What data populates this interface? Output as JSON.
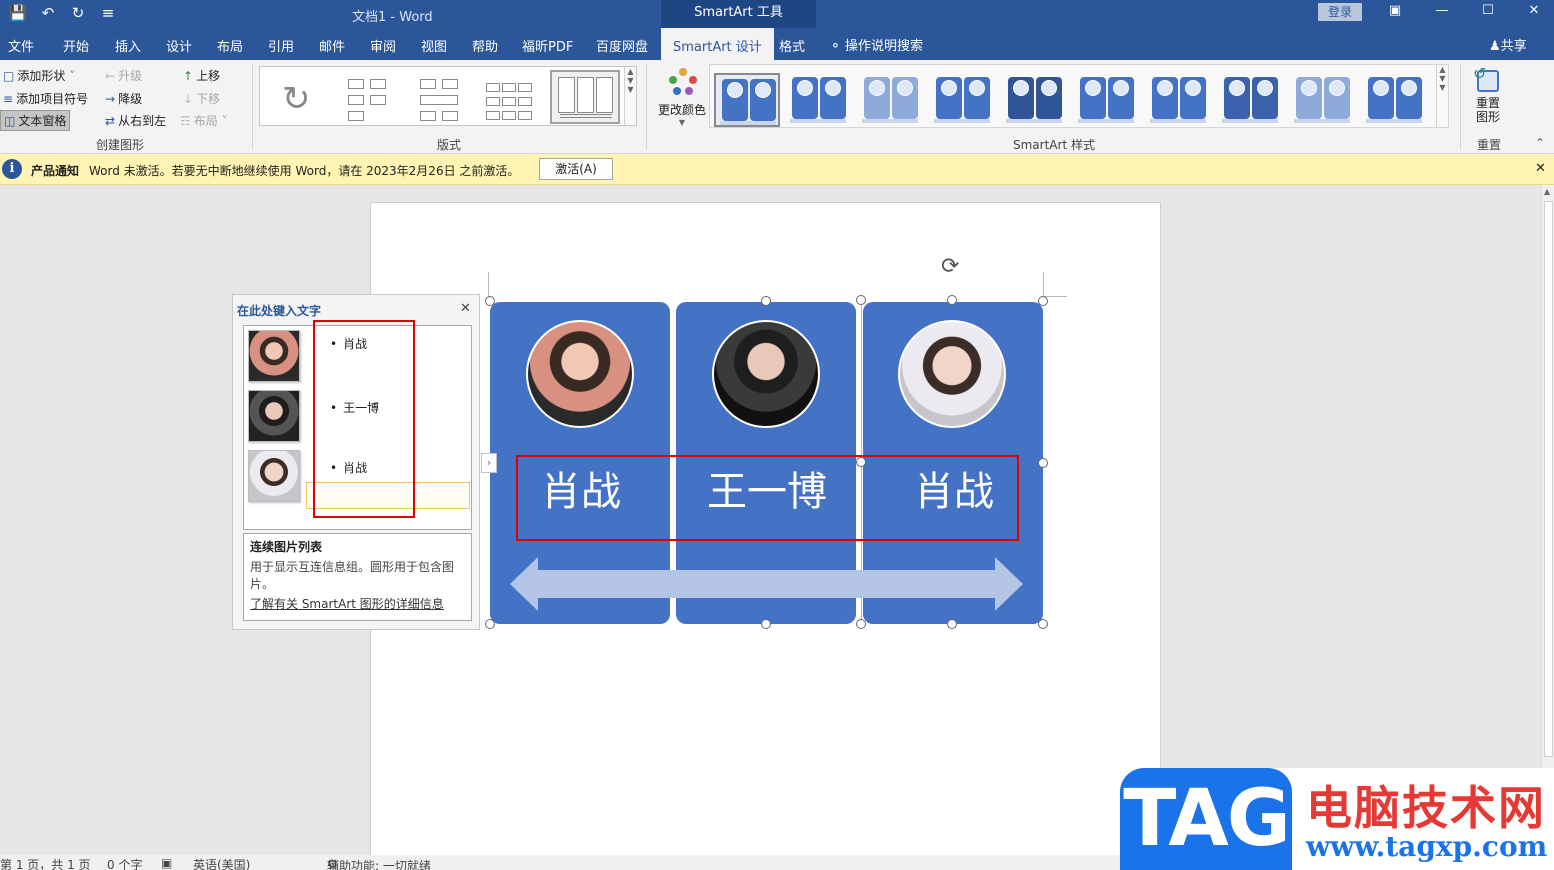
{
  "titlebar": {
    "doc_title": "文档1  -  Word",
    "tools_title": "SmartArt 工具",
    "login": "登录"
  },
  "tabs": [
    {
      "label": "文件"
    },
    {
      "label": "开始"
    },
    {
      "label": "插入"
    },
    {
      "label": "设计"
    },
    {
      "label": "布局"
    },
    {
      "label": "引用"
    },
    {
      "label": "邮件"
    },
    {
      "label": "审阅"
    },
    {
      "label": "视图"
    },
    {
      "label": "帮助"
    },
    {
      "label": "福昕PDF"
    },
    {
      "label": "百度网盘"
    },
    {
      "label": "SmartArt 设计"
    },
    {
      "label": "格式"
    }
  ],
  "tell_me": "操作说明搜索",
  "share": "共享",
  "ribbon": {
    "create": {
      "add_shape": "添加形状",
      "add_bullet": "添加项目符号",
      "text_pane": "文本窗格",
      "promote": "升级",
      "demote": "降级",
      "rtl": "从右到左",
      "move_up": "上移",
      "move_down": "下移",
      "layout": "布局",
      "label": "创建图形"
    },
    "layouts_label": "版式",
    "change_colors": "更改颜色",
    "styles_label": "SmartArt 样式",
    "reset_graphic": "重置\n图形",
    "reset_label": "重置"
  },
  "notice": {
    "title": "产品通知",
    "message": "Word 未激活。若要无中断地继续使用 Word，请在 2023年2月26日 之前激活。",
    "button": "激活(A)"
  },
  "smartart": {
    "items": [
      {
        "name": "肖战"
      },
      {
        "name": "王一博"
      },
      {
        "name": "肖战"
      }
    ],
    "card_color": "#4472c4"
  },
  "text_pane": {
    "title": "在此处键入文字",
    "bullets": [
      "肖战",
      "王一博",
      "肖战"
    ],
    "desc_title": "连续图片列表",
    "desc_body": "用于显示互连信息组。圆形用于包含图片。",
    "desc_link": "了解有关 SmartArt 图形的详细信息"
  },
  "status": {
    "page": "第 1 页，共 1 页",
    "words": "0 个字",
    "lang": "英语(美国)",
    "access": "辅助功能: 一切就绪"
  },
  "watermark": {
    "tag": "TAG",
    "cn": "电脑技术网",
    "url": "www.tagxp.com"
  }
}
